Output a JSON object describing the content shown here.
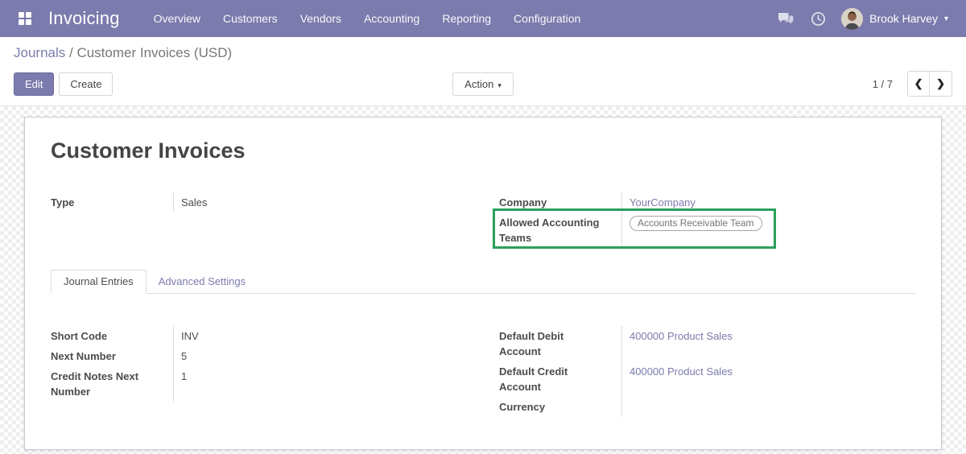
{
  "navbar": {
    "brand": "Invoicing",
    "menu_items": [
      "Overview",
      "Customers",
      "Vendors",
      "Accounting",
      "Reporting",
      "Configuration"
    ],
    "icons": {
      "apps": "apps-grid-icon",
      "messages": "chat-bubbles-icon",
      "activities": "clock-icon",
      "user_caret": "▾"
    },
    "user_name": "Brook Harvey"
  },
  "breadcrumb": {
    "parent": "Journals",
    "separator": " / ",
    "current": "Customer Invoices (USD)"
  },
  "control_panel": {
    "edit_label": "Edit",
    "create_label": "Create",
    "action_label": "Action",
    "action_caret": "▾",
    "pager": {
      "value": "1 / 7",
      "prev_icon": "❮",
      "next_icon": "❯"
    }
  },
  "form": {
    "title": "Customer Invoices",
    "top_left_fields": [
      {
        "label": "Type",
        "value": "Sales"
      }
    ],
    "top_right_fields": [
      {
        "label": "Company",
        "value": "YourCompany"
      },
      {
        "label": "Allowed Accounting Teams",
        "badge": "Accounts Receivable Team"
      }
    ],
    "tabs": [
      {
        "label": "Journal Entries",
        "active": true
      },
      {
        "label": "Advanced Settings",
        "active": false
      }
    ],
    "bottom_left_fields": [
      {
        "label": "Short Code",
        "value": "INV"
      },
      {
        "label": "Next Number",
        "value": "5"
      },
      {
        "label": "Credit Notes Next Number",
        "value": "1"
      }
    ],
    "bottom_right_fields": [
      {
        "label": "Default Debit Account",
        "value": "400000 Product Sales"
      },
      {
        "label": "Default Credit Account",
        "value": "400000 Product Sales"
      },
      {
        "label": "Currency",
        "value": ""
      }
    ]
  },
  "colors": {
    "navbar_background": "#7c7bad",
    "link": "#7c7bad",
    "text": "#4c4c4c",
    "annotation_highlight": "#28a05a"
  }
}
